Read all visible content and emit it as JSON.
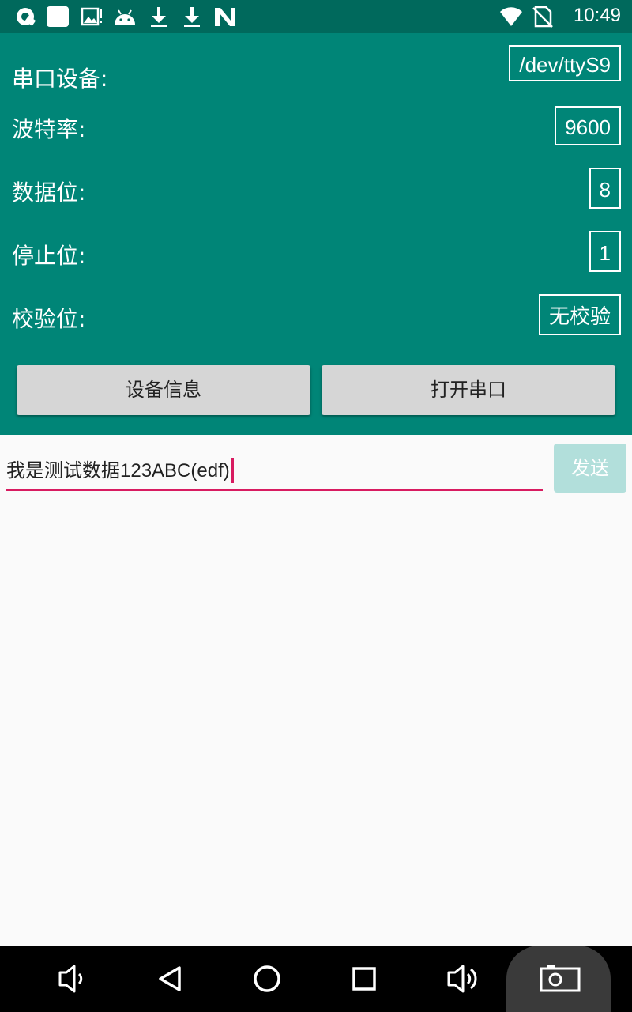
{
  "status_bar": {
    "time": "10:49",
    "icons": [
      "quick-search-icon",
      "notification-square-icon",
      "gallery-alert-icon",
      "android-icon",
      "download-icon",
      "download-icon",
      "n-logo-icon",
      "wifi-icon",
      "no-sim-icon"
    ]
  },
  "settings": {
    "serial_device": {
      "label": "串口设备:",
      "value": "/dev/ttyS9"
    },
    "baud_rate": {
      "label": "波特率:",
      "value": "9600"
    },
    "data_bits": {
      "label": "数据位:",
      "value": "8"
    },
    "stop_bits": {
      "label": "停止位:",
      "value": "1"
    },
    "parity": {
      "label": "校验位:",
      "value": "无校验"
    }
  },
  "buttons": {
    "device_info": "设备信息",
    "open_port": "打开串口"
  },
  "send": {
    "input_value": "我是测试数据123ABC(edf)",
    "button_label": "发送"
  },
  "colors": {
    "status_bar": "#00695c",
    "panel": "#008577",
    "accent": "#d81b60"
  },
  "nav_bar": {
    "icons": [
      "volume-down-icon",
      "back-icon",
      "home-icon",
      "recents-icon",
      "volume-up-icon",
      "screenshot-icon"
    ]
  }
}
